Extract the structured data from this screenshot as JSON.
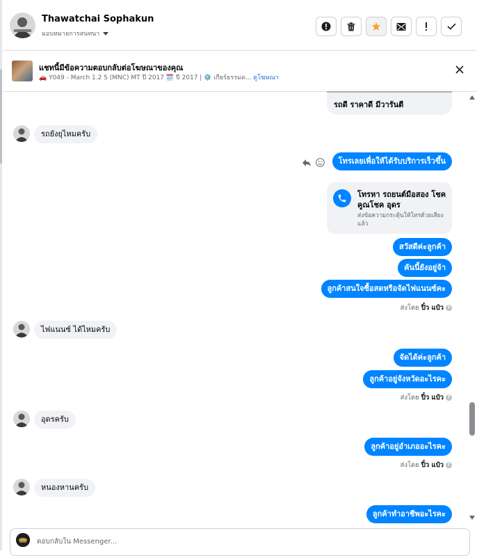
{
  "colors": {
    "accent": "#0084ff",
    "incoming_bubble": "#f0f2f5",
    "star": "#f5a623",
    "link": "#216fdb"
  },
  "header": {
    "contact_name": "Thawatchai Sophakun",
    "assign_label": "มอบหมายการสนทนา",
    "actions": [
      {
        "icon": "spam-report-icon"
      },
      {
        "icon": "trash-icon"
      },
      {
        "icon": "star-icon"
      },
      {
        "icon": "mark-unread-icon"
      },
      {
        "icon": "exclamation-icon"
      },
      {
        "icon": "check-icon"
      }
    ]
  },
  "ad": {
    "title": "แชทนี้มีข้อความตอบกลับต่อโฆษณาของคุณ",
    "subtitle": "🚗 Y049 - March 1.2 S (MNC) MT ปี 2017 🗓️ ปี 2017 | ⚙️ เกียร์ธรรมด...",
    "link": "ดูโฆษณา"
  },
  "messages": {
    "card_fragment": "รถดี ราคาดี มีวารันตี",
    "in_1": "รถยังยุไหมครับ",
    "out_1": "โทรเลยเพื่อให้ได้รับบริการเร็วขึ้น",
    "call_card": {
      "title": "โทรหา รถยนต์มือสอง โชคคูณโชค อุดร",
      "subtitle": "ส่งข้อความกระตุ้นให้โทรด้วยเสียงแล้ว"
    },
    "out_2": "สวัสดีค่ะลูกค้า",
    "out_3": "คันนี้ยังอยู่จ้า",
    "out_4": "ลูกค้าสนใจซื้อสดหรือจัดไฟแนนซ์คะ",
    "in_2": "ไฟแนนซ์ ได้ไหมครับ",
    "out_5": "จัดได้ค่ะลูกค้า",
    "out_6": "ลูกค้าอยู่จังหวัดอะไรคะ",
    "in_3": "อุดรครับ",
    "out_7": "ลูกค้าอยู่อำเภออะไรคะ",
    "in_4": "หนองหานครับ",
    "out_8": "ลูกค้าทำอาชีพอะไรคะ",
    "sent_by_label": "ส่งโดย",
    "sent_by_name": "ปิ๋ว แป๋ว"
  },
  "composer": {
    "placeholder": "ตอบกลับใน Messenger..."
  }
}
